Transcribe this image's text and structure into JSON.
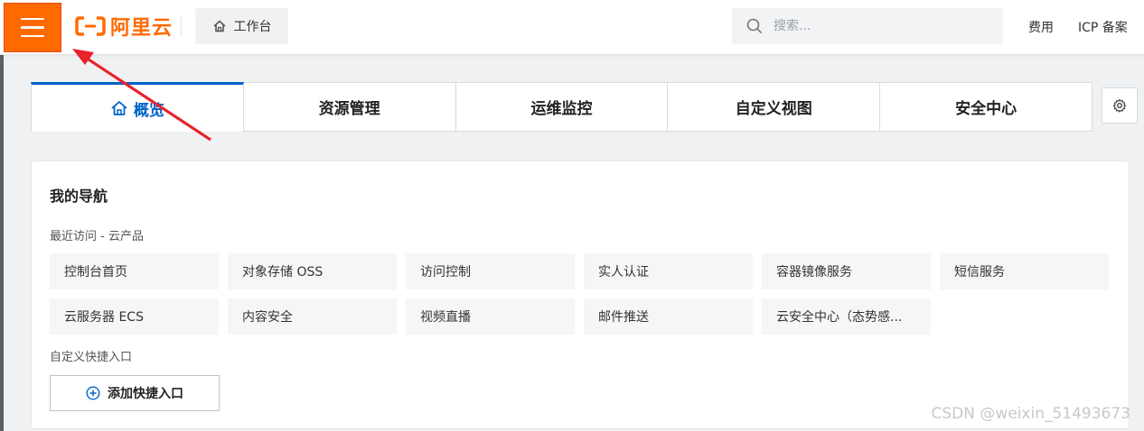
{
  "topbar": {
    "logo_text": "阿里云",
    "workbench_label": "工作台",
    "search_placeholder": "搜索...",
    "links": [
      "费用",
      "ICP 备案"
    ],
    "brand_color": "#ff6a00"
  },
  "tabs": [
    {
      "label": "概览",
      "active": true
    },
    {
      "label": "资源管理",
      "active": false
    },
    {
      "label": "运维监控",
      "active": false
    },
    {
      "label": "自定义视图",
      "active": false
    },
    {
      "label": "安全中心",
      "active": false
    }
  ],
  "nav": {
    "title": "我的导航",
    "recent_label": "最近访问 - 云产品",
    "recent_items": [
      "控制台首页",
      "对象存储 OSS",
      "访问控制",
      "实人认证",
      "容器镜像服务",
      "短信服务",
      "云服务器 ECS",
      "内容安全",
      "视频直播",
      "邮件推送",
      "云安全中心（态势感..."
    ],
    "custom_label": "自定义快捷入口",
    "add_button_label": "添加快捷入口"
  },
  "watermark": "CSDN @weixin_51493673",
  "accent_color": "#0064c8",
  "annotation_color": "#e8222a"
}
